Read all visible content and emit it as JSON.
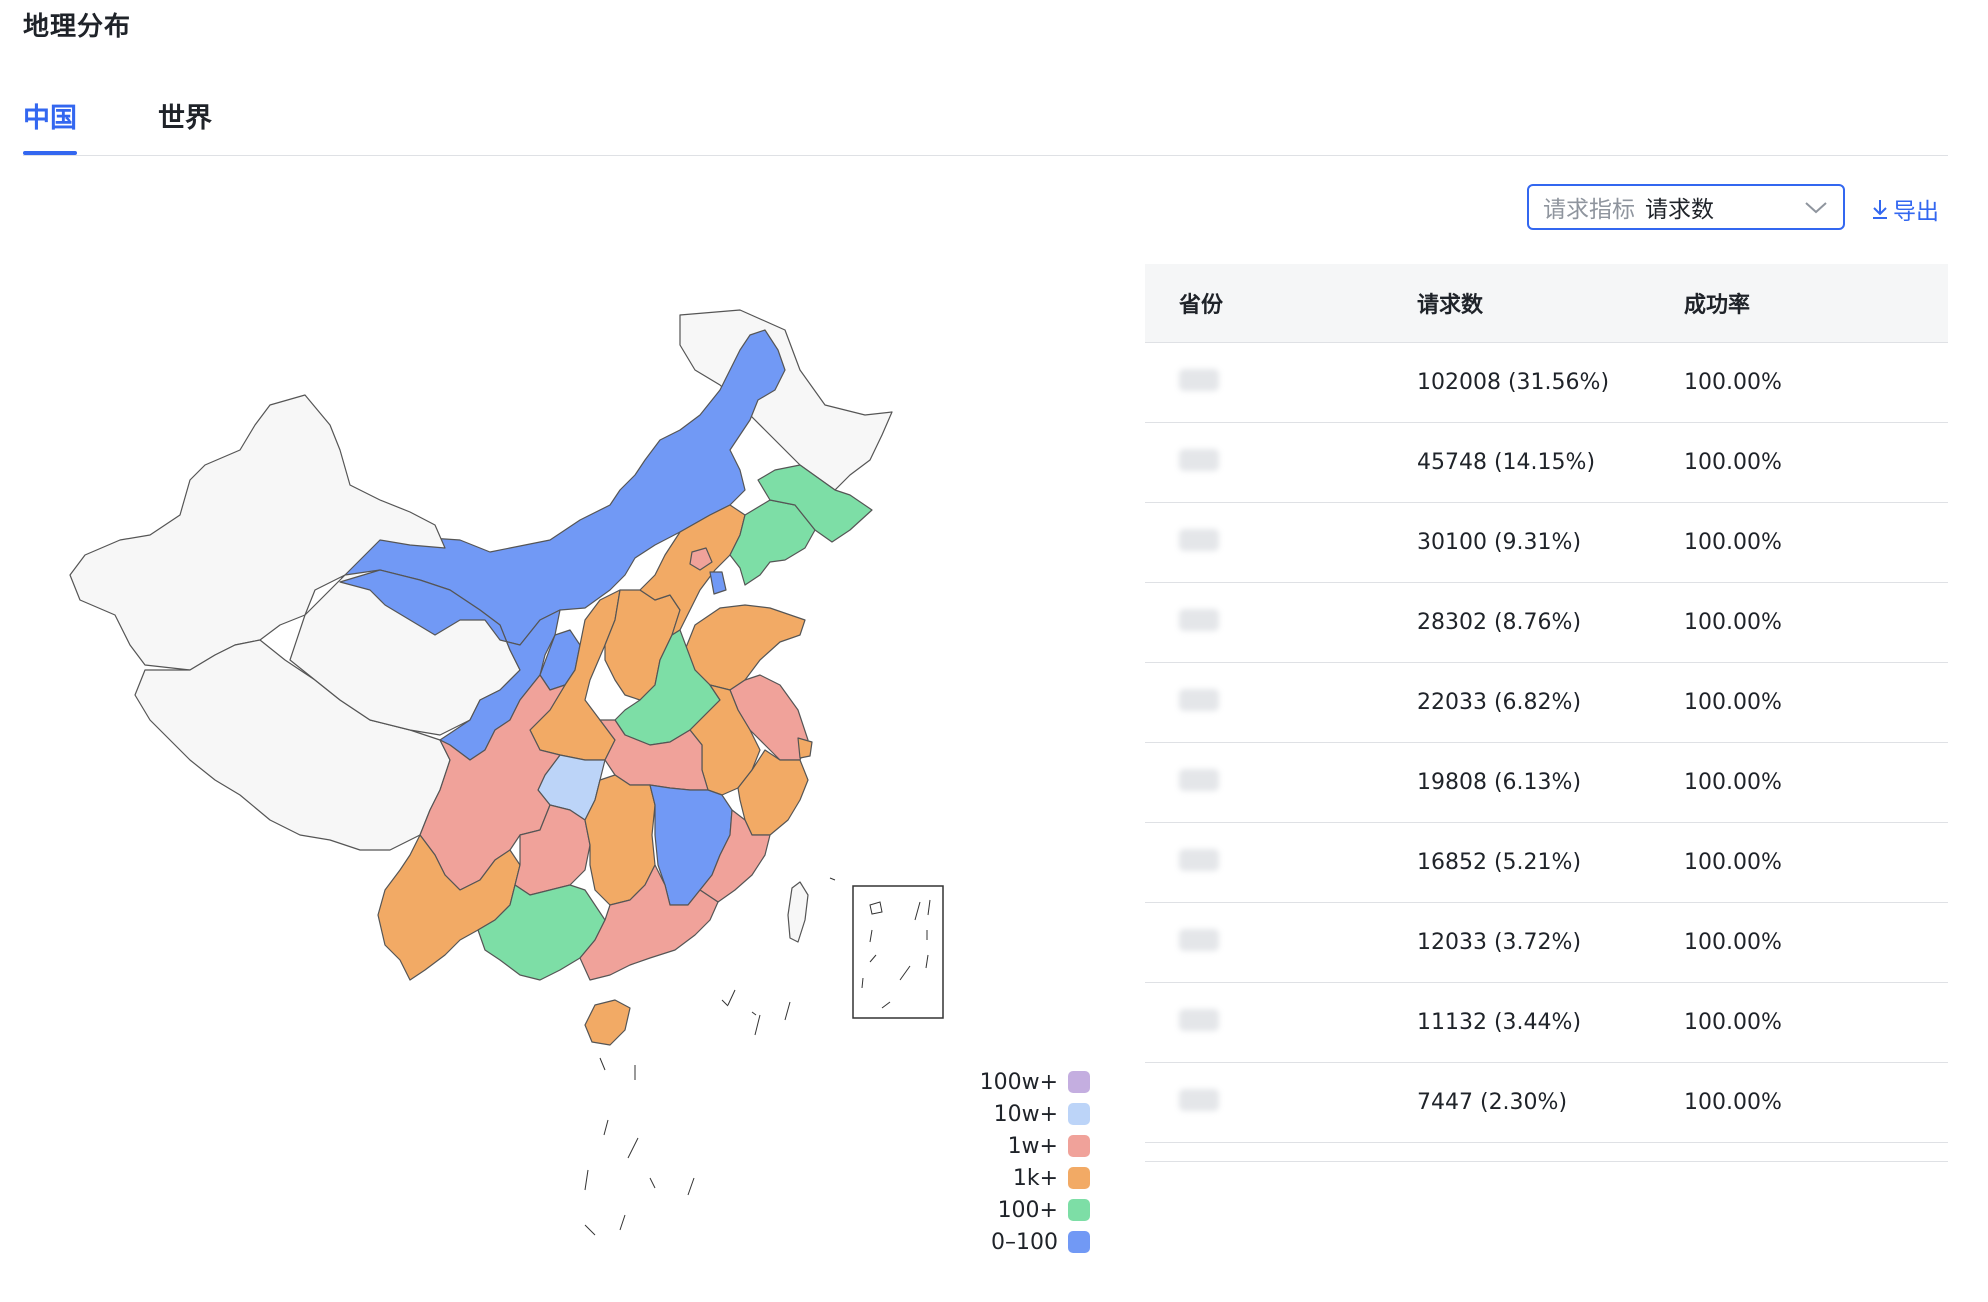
{
  "page": {
    "title": "地理分布"
  },
  "tabs": [
    {
      "label": "中国",
      "active": true
    },
    {
      "label": "世界",
      "active": false
    }
  ],
  "metric_select": {
    "label": "请求指标",
    "value": "请求数"
  },
  "export": {
    "label": "导出"
  },
  "table": {
    "headers": [
      "省份",
      "请求数",
      "成功率"
    ],
    "rows": [
      {
        "requests": "102008 (31.56%)",
        "success": "100.00%"
      },
      {
        "requests": "45748 (14.15%)",
        "success": "100.00%"
      },
      {
        "requests": "30100 (9.31%)",
        "success": "100.00%"
      },
      {
        "requests": "28302 (8.76%)",
        "success": "100.00%"
      },
      {
        "requests": "22033 (6.82%)",
        "success": "100.00%"
      },
      {
        "requests": "19808 (6.13%)",
        "success": "100.00%"
      },
      {
        "requests": "16852 (5.21%)",
        "success": "100.00%"
      },
      {
        "requests": "12033 (3.72%)",
        "success": "100.00%"
      },
      {
        "requests": "11132 (3.44%)",
        "success": "100.00%"
      },
      {
        "requests": "7447 (2.30%)",
        "success": "100.00%"
      }
    ]
  },
  "legend": [
    {
      "label": "100w+",
      "color": "#c4aee0"
    },
    {
      "label": "10w+",
      "color": "#bcd4f8"
    },
    {
      "label": "1w+",
      "color": "#f0a29a"
    },
    {
      "label": "1k+",
      "color": "#f2aa65"
    },
    {
      "label": "100+",
      "color": "#7ddea6"
    },
    {
      "label": "0–100",
      "color": "#7199f5"
    }
  ],
  "colors": {
    "accent": "#3367f0",
    "no_data": "#f7f7f7"
  }
}
